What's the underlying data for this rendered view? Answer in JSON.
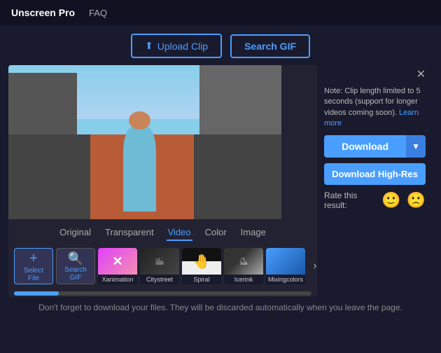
{
  "nav": {
    "brand": "Unscreen Pro",
    "faq": "FAQ"
  },
  "header": {
    "upload_label": "Upload Clip",
    "search_label": "Search GIF",
    "upload_icon": "⬆"
  },
  "tabs": [
    {
      "id": "original",
      "label": "Original",
      "active": false
    },
    {
      "id": "transparent",
      "label": "Transparent",
      "active": false
    },
    {
      "id": "video",
      "label": "Video",
      "active": true
    },
    {
      "id": "color",
      "label": "Color",
      "active": false
    },
    {
      "id": "image",
      "label": "Image",
      "active": false
    }
  ],
  "thumbnails": [
    {
      "id": "select-file",
      "label": "Select\nFile",
      "type": "select"
    },
    {
      "id": "search-gif",
      "label": "Search\nGIF",
      "type": "search"
    },
    {
      "id": "xanimation",
      "label": "Xanimation",
      "type": "pink"
    },
    {
      "id": "citystreet",
      "label": "Citystreet",
      "type": "dark"
    },
    {
      "id": "spiral",
      "label": "Spiral",
      "type": "hand"
    },
    {
      "id": "icerink",
      "label": "Icerink",
      "type": "ice"
    },
    {
      "id": "mixingcolors",
      "label": "Mixingcolors",
      "type": "blue"
    }
  ],
  "right_panel": {
    "close_icon": "✕",
    "note": "Note: Clip length limited to 5 seconds (support for longer videos coming soon).",
    "learn_more": "Learn more",
    "download_label": "Download",
    "download_hires_label": "Download High-Res",
    "rate_label": "Rate this result:",
    "happy_emoji": "🙂",
    "sad_emoji": "🙁"
  },
  "footer": {
    "text": "Don't forget to download your files. They will be discarded automatically when you leave the page."
  }
}
